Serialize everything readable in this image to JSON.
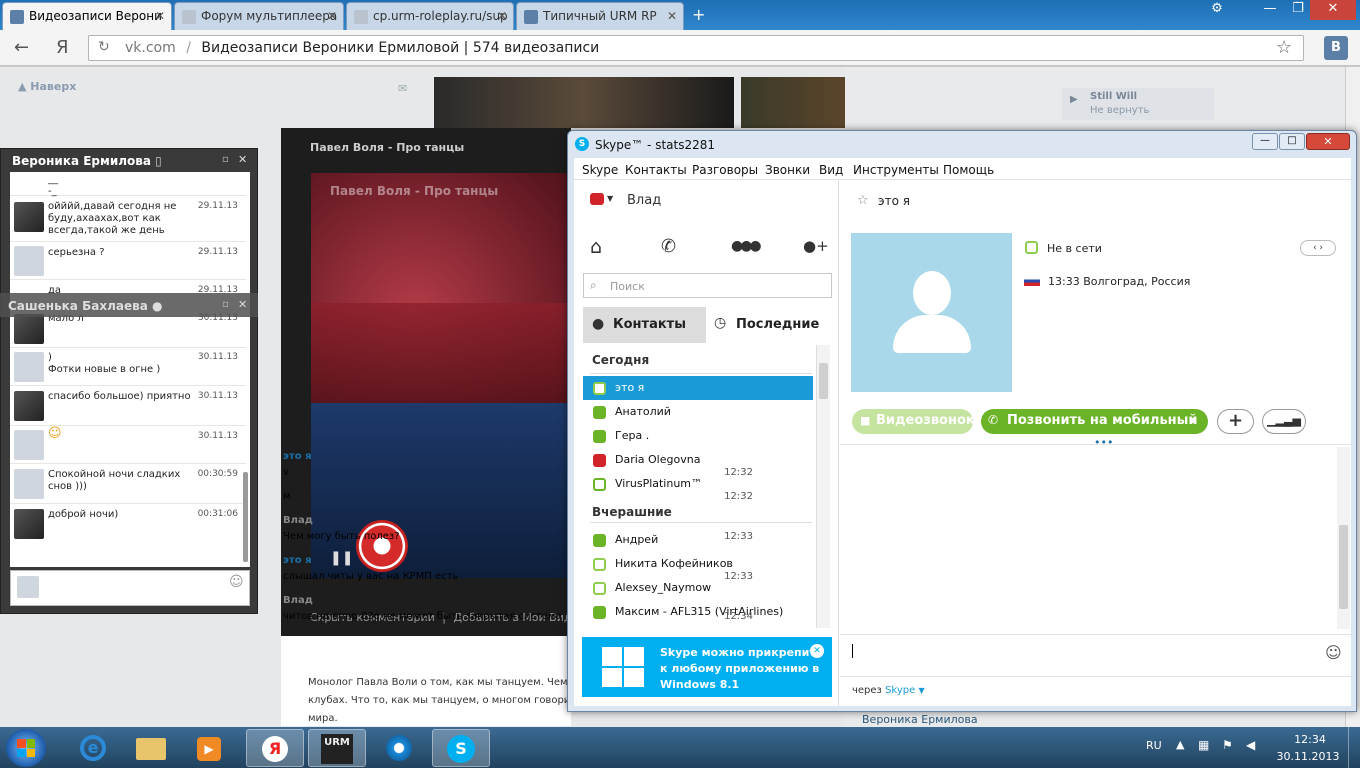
{
  "browser": {
    "tabs": [
      {
        "label": "Видеозаписи Верони",
        "active": true
      },
      {
        "label": "Форум мультиплеера",
        "active": false
      },
      {
        "label": "cp.urm-roleplay.ru/sup",
        "active": false
      },
      {
        "label": "Типичный URM RP",
        "active": false
      }
    ],
    "address_host": "vk.com",
    "address_title": "Видеозаписи Вероники Ермиловой | 574 видеозаписи",
    "yandex_letter": "Я",
    "ext_letter": "В"
  },
  "page": {
    "back_to_top": "Наверх",
    "video_title": "Павел Воля - Про танцы",
    "video_overlay_title": "Павел Воля - Про танцы",
    "hide_comments": "Скрыть комментарии",
    "separator": "|",
    "add_to_videos": "Добавить в Мои Видеозапи",
    "description_lines": [
      "Монолог Павла Воли о том, как мы танцуем. Чем о",
      "клубах. Что то, как мы танцуем, о многом говорит",
      "мира."
    ],
    "player_label": "Still Will",
    "player_sub": "Не вернуть",
    "bottom_name": "Вероника Ермилова"
  },
  "chat1": {
    "title": "Вероника Ермилова",
    "messages": [
      {
        "text": "__\n-_",
        "time": ""
      },
      {
        "text": "ойййй,давай сегодня не буду,ахаахах,вот как всегда,такой же день",
        "time": "29.11.13"
      },
      {
        "text": "серьезна ?",
        "time": "29.11.13"
      },
      {
        "text": "да",
        "time": "29.11.13"
      },
      {
        "text": "мало л",
        "time": "30.11.13"
      },
      {
        "text": ")\nФотки новые в огне )",
        "time": "30.11.13"
      },
      {
        "text": "спасибо большое) приятно",
        "time": "30.11.13"
      },
      {
        "text": "☺",
        "time": "30.11.13"
      },
      {
        "text": "Спокойной ночи сладких снов )))",
        "time": "00:30:59"
      },
      {
        "text": "доброй ночи)",
        "time": "00:31:06"
      }
    ]
  },
  "chat2": {
    "title": "Сашенька Бахлаева ●"
  },
  "skype": {
    "window_title": "Skype™ - stats2281",
    "menu": [
      "Skype",
      "Контакты",
      "Разговоры",
      "Звонки",
      "Вид",
      "Инструменты",
      "Помощь"
    ],
    "user_name": "Влад",
    "search_placeholder": "Поиск",
    "tab_contacts": "Контакты",
    "tab_recent": "Последние",
    "group_today": "Сегодня",
    "group_yesterday": "Вчерашние",
    "contacts_today": [
      {
        "name": "это я",
        "status": "off",
        "selected": true
      },
      {
        "name": "Анатолий",
        "status": "on"
      },
      {
        "name": "Гера .",
        "status": "on"
      },
      {
        "name": "Daria Olegovna",
        "status": "red"
      },
      {
        "name": "VirusPlatinum™",
        "status": "fw"
      }
    ],
    "contacts_yesterday": [
      {
        "name": "Андрей",
        "status": "on"
      },
      {
        "name": "Никита Кофейников",
        "status": "off"
      },
      {
        "name": "Alexsey_Naymow",
        "status": "off"
      },
      {
        "name": "Максим - AFL315 (VirtAirlines)",
        "status": "on"
      }
    ],
    "promo_lines": [
      "Skype можно прикрепить",
      "к любому приложению в",
      "Windows 8.1"
    ],
    "profile_name": "это я",
    "profile_status": "Не в сети",
    "profile_time_loc": "13:33 Волгоград, Россия",
    "video_call": "Видеозвонок",
    "call_mobile": "Позвонить на мобильный",
    "messages": [
      {
        "sender": "это я",
        "lines": [
          {
            "text": "v",
            "time": "12:32"
          },
          {
            "text": "м",
            "time": "12:32"
          }
        ]
      },
      {
        "sender": "Влад",
        "lines": [
          {
            "text": "Чем могу быть полез?",
            "time": "12:33"
          }
        ]
      },
      {
        "sender": "это я",
        "lines": [
          {
            "text": "слышал читы у вас на КРМП есть",
            "time": "12:33"
          }
        ]
      },
      {
        "sender": "Влад",
        "lines": [
          {
            "text": "читов на crmp 03е не может быть закрытая система",
            "time": "12:34"
          }
        ]
      }
    ],
    "via_label": "через",
    "via_value": "Skype"
  },
  "taskbar": {
    "lang": "RU",
    "time": "12:34",
    "date": "30.11.2013",
    "urm_label": "URM"
  },
  "colors": {
    "skype_blue": "#1a9bd7",
    "skype_green": "#6bb427",
    "vk_blue": "#5b7fa6"
  }
}
